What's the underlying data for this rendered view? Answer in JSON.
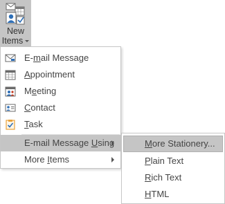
{
  "ribbon": {
    "button": {
      "line1": "New",
      "line2": "Items",
      "icon": "new-items-icon"
    }
  },
  "menu": {
    "items": [
      {
        "pre": "E-",
        "key": "m",
        "post": "ail Message",
        "icon": "email-message-icon"
      },
      {
        "pre": "",
        "key": "A",
        "post": "ppointment",
        "icon": "appointment-icon"
      },
      {
        "pre": "M",
        "key": "e",
        "post": "eting",
        "icon": "meeting-icon"
      },
      {
        "pre": "",
        "key": "C",
        "post": "ontact",
        "icon": "contact-icon"
      },
      {
        "pre": "",
        "key": "T",
        "post": "ask",
        "icon": "task-icon"
      },
      {
        "pre": "E-mail Message ",
        "key": "U",
        "post": "sing",
        "icon": "chevron-right-icon"
      },
      {
        "pre": "More ",
        "key": "I",
        "post": "tems",
        "icon": "chevron-right-icon"
      }
    ]
  },
  "submenu": {
    "items": [
      {
        "pre": "",
        "key": "M",
        "post": "ore Stationery..."
      },
      {
        "pre": "",
        "key": "P",
        "post": "lain Text"
      },
      {
        "pre": "",
        "key": "R",
        "post": "ich Text"
      },
      {
        "pre": "",
        "key": "H",
        "post": "TML"
      }
    ]
  },
  "colors": {
    "highlight": "#c5c5c5",
    "menu_border": "#c6c6c6",
    "text": "#444444",
    "email_icon_blue": "#2e6fb7",
    "calendar_red": "#c23b22",
    "task_orange": "#e8a33c"
  }
}
